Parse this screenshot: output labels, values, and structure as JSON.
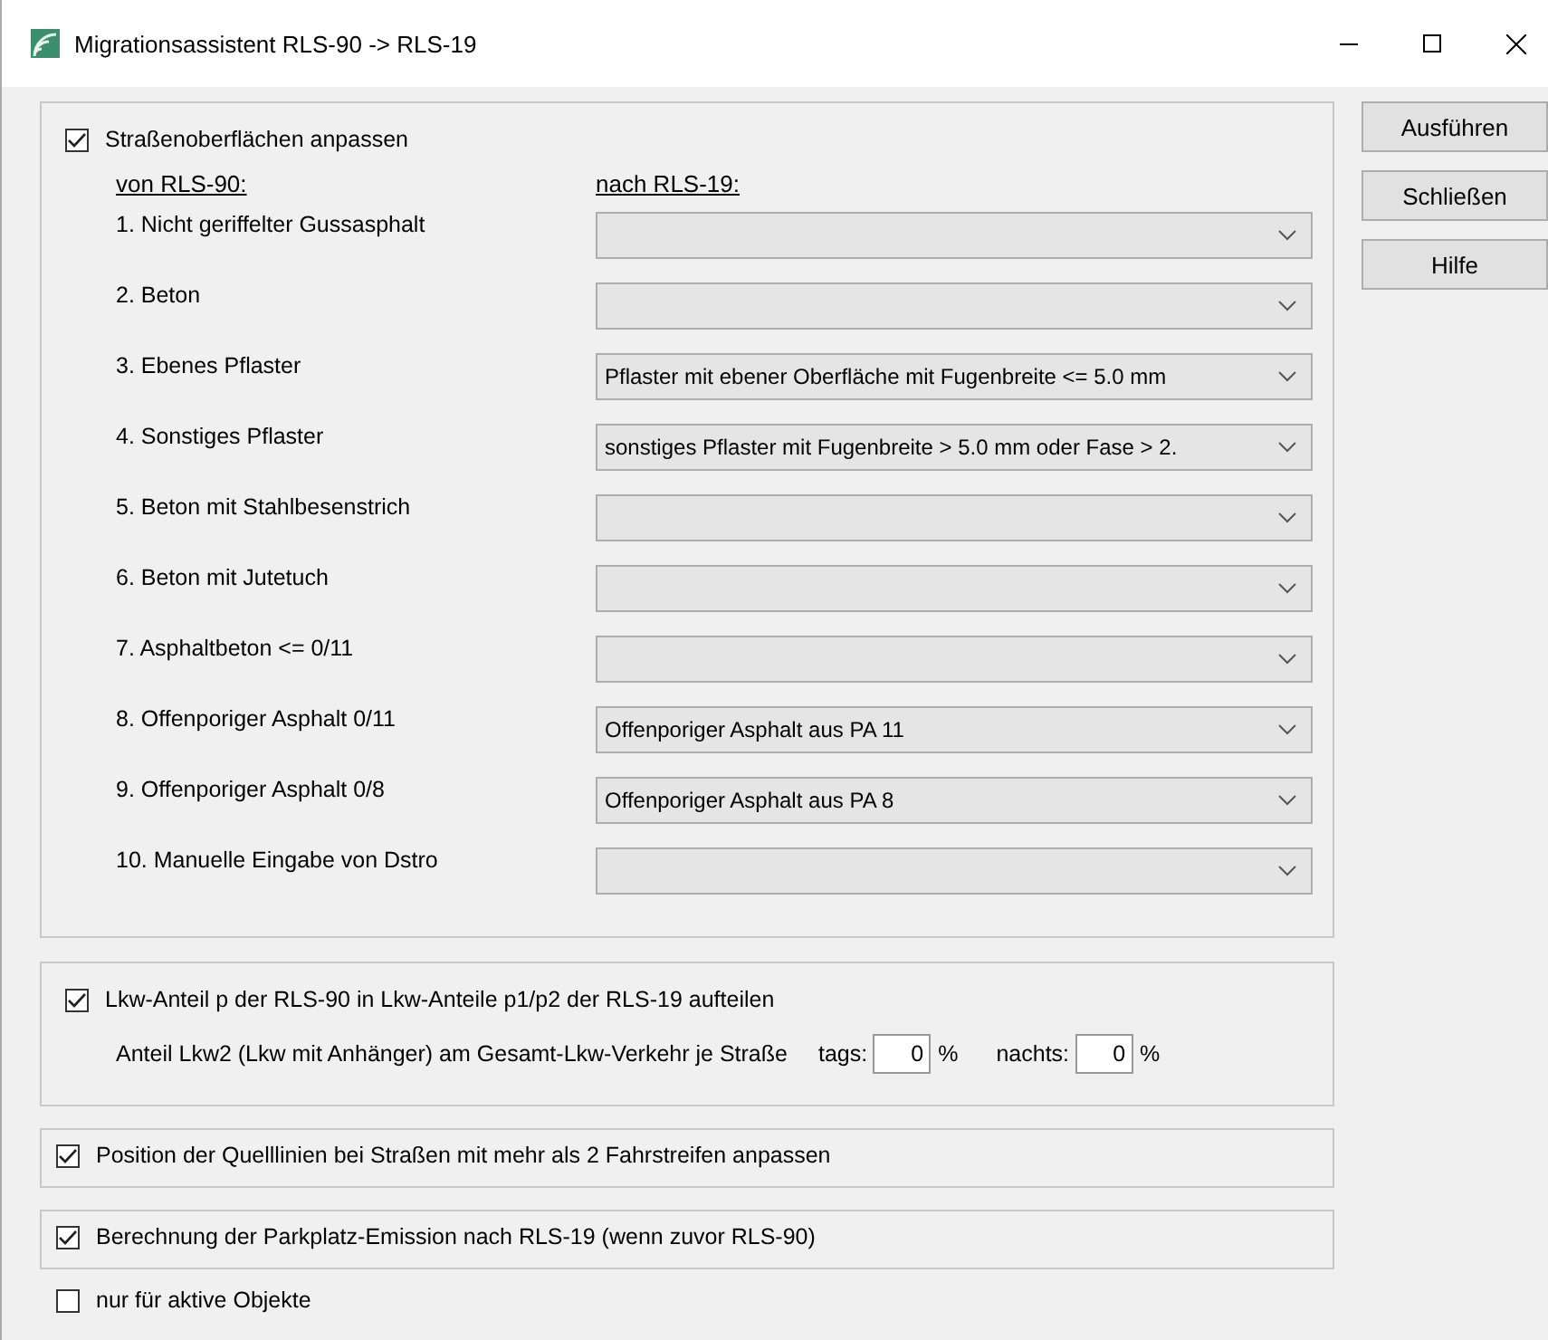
{
  "window": {
    "title": "Migrationsassistent RLS-90 -> RLS-19"
  },
  "surfaces": {
    "label": "Straßenoberflächen anpassen",
    "checked": true,
    "from_header": "von RLS-90:",
    "to_header": "nach RLS-19:",
    "rows": [
      {
        "label": "1.  Nicht geriffelter Gussasphalt"
      },
      {
        "label": "2.  Beton"
      },
      {
        "label": "3.  Ebenes Pflaster",
        "value": "Pflaster mit ebener Oberfläche mit Fugenbreite <= 5.0 mm"
      },
      {
        "label": "4.  Sonstiges Pflaster",
        "value": "sonstiges Pflaster mit Fugenbreite > 5.0 mm oder Fase > 2."
      },
      {
        "label": "5.  Beton mit Stahlbesenstrich"
      },
      {
        "label": "6.  Beton mit Jutetuch"
      },
      {
        "label": "7.  Asphaltbeton <= 0/11"
      },
      {
        "label": "8.  Offenporiger Asphalt 0/11",
        "value": "Offenporiger Asphalt aus PA 11"
      },
      {
        "label": "9.  Offenporiger Asphalt 0/8",
        "value": "Offenporiger Asphalt aus PA 8"
      },
      {
        "label": "10. Manuelle Eingabe von Dstro"
      }
    ]
  },
  "trucks": {
    "label": "Lkw-Anteil p der RLS-90 in Lkw-Anteile p1/p2 der RLS-19 aufteilen",
    "checked": true,
    "share_label": "Anteil Lkw2 (Lkw mit Anhänger) am Gesamt-Lkw-Verkehr je Straße",
    "day_label": "tags:",
    "day_value": "0",
    "day_unit": "%",
    "night_label": "nachts:",
    "night_value": "0",
    "night_unit": "%"
  },
  "source_lines": {
    "label": "Position der Quelllinien bei Straßen mit mehr als 2 Fahrstreifen anpassen",
    "checked": true
  },
  "parking": {
    "label": "Berechnung der Parkplatz-Emission nach RLS-19 (wenn zuvor RLS-90)",
    "checked": true
  },
  "active_only": {
    "label": "nur für aktive Objekte",
    "checked": false
  },
  "buttons": [
    "Ausführen",
    "Schließen",
    "Hilfe"
  ]
}
